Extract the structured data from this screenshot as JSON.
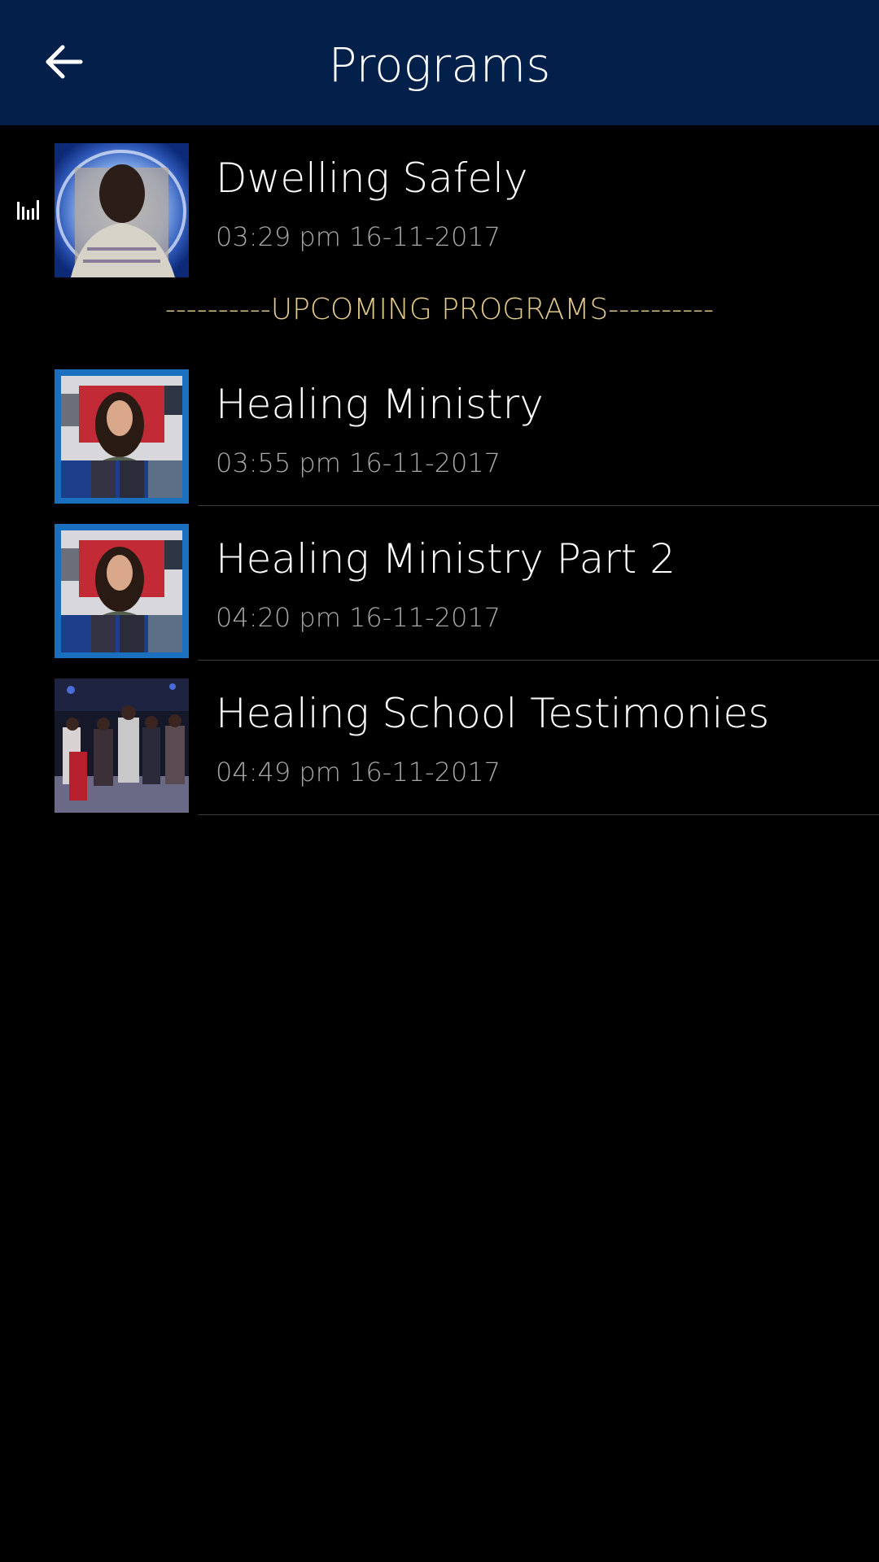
{
  "header": {
    "title": "Programs",
    "back_icon": "arrow-left-icon"
  },
  "now_playing": {
    "icon": "equalizer-icon",
    "title": "Dwelling Safely",
    "time": "03:29 pm 16-11-2017"
  },
  "upcoming": {
    "section_label": "----------UPCOMING PROGRAMS----------",
    "items": [
      {
        "title": "Healing Ministry",
        "time": "03:55 pm 16-11-2017"
      },
      {
        "title": "Healing Ministry Part 2",
        "time": "04:20 pm 16-11-2017"
      },
      {
        "title": "Healing School Testimonies",
        "time": "04:49 pm 16-11-2017"
      }
    ]
  },
  "colors": {
    "header_bg": "#03204a",
    "background": "#000000",
    "section_label": "#e2c98d",
    "subtext": "#a8a8a8"
  }
}
